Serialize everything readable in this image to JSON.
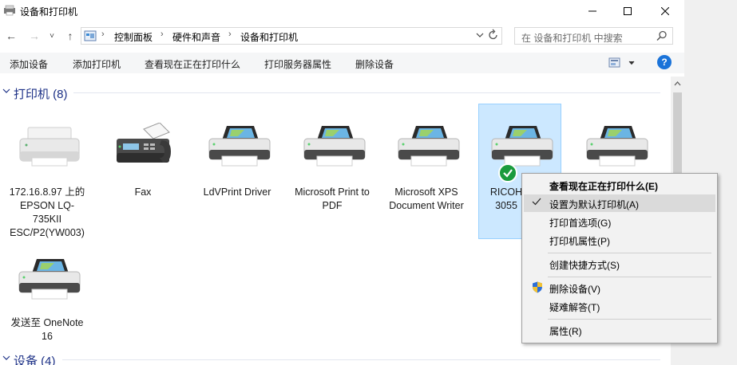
{
  "window": {
    "title": "设备和打印机",
    "controls": {
      "minimize": "—",
      "maximize": "☐",
      "close": "✕"
    }
  },
  "nav": {
    "back": "←",
    "forward": "→",
    "recent": "˅",
    "up": "↑",
    "breadcrumbs": [
      "控制面板",
      "硬件和声音",
      "设备和打印机"
    ],
    "separator": "›",
    "search_placeholder": "在 设备和打印机 中搜索"
  },
  "commands": [
    "添加设备",
    "添加打印机",
    "查看现在正在打印什么",
    "打印服务器属性",
    "删除设备"
  ],
  "help": "?",
  "groups": {
    "printers": {
      "title": "打印机 (8)"
    },
    "devices": {
      "title": "设备 (4)"
    }
  },
  "printers": [
    {
      "label": "172.16.8.97 上的 EPSON LQ-735KII ESC/P2(YW003)",
      "icon": "dot-matrix-printer-icon"
    },
    {
      "label": "Fax",
      "icon": "fax-icon"
    },
    {
      "label": "LdVPrint Driver",
      "icon": "printer-icon"
    },
    {
      "label": "Microsoft Print to PDF",
      "icon": "printer-icon"
    },
    {
      "label": "Microsoft XPS Document Writer",
      "icon": "printer-icon"
    },
    {
      "label": "RICOH 3055",
      "icon": "printer-icon",
      "selected": true,
      "default": true
    },
    {
      "label": "",
      "icon": "printer-icon"
    },
    {
      "label": "发送至 OneNote 16",
      "icon": "printer-icon"
    }
  ],
  "context_menu": {
    "items": [
      {
        "label": "查看现在正在打印什么(E)",
        "bold": true
      },
      {
        "label": "设置为默认打印机(A)",
        "checked": true,
        "highlighted": true
      },
      {
        "label": "打印首选项(G)"
      },
      {
        "label": "打印机属性(P)"
      },
      {
        "label": "创建快捷方式(S)"
      },
      {
        "label": "删除设备(V)",
        "icon": "uac-shield-icon"
      },
      {
        "label": "疑难解答(T)"
      },
      {
        "label": "属性(R)"
      }
    ]
  },
  "colors": {
    "group_title": "#1e3287",
    "selection_fill": "#cce8ff",
    "selection_border": "#99d1ff",
    "default_badge": "#1a9b3d",
    "help": "#1a73d9"
  }
}
